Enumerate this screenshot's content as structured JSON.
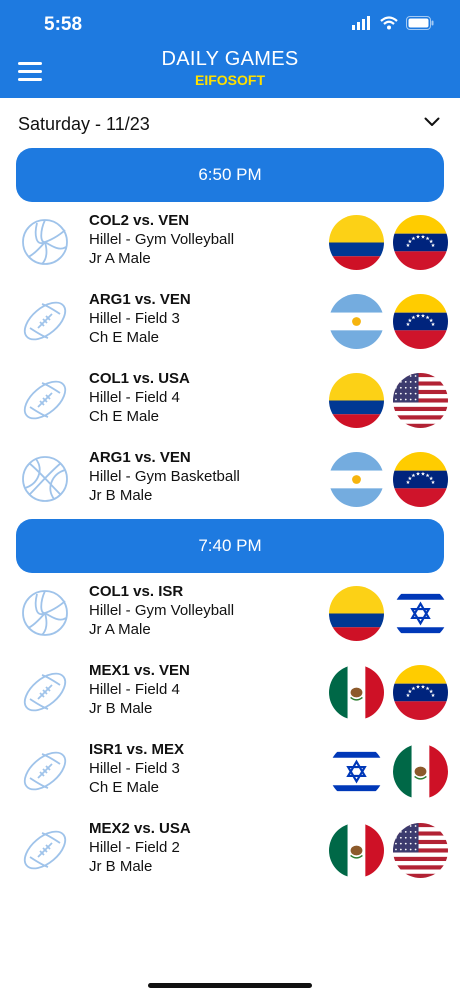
{
  "status_bar": {
    "time": "5:58"
  },
  "header": {
    "title": "DAILY GAMES",
    "subtitle": "EIFOSOFT"
  },
  "date_selector": {
    "label": "Saturday - 11/23"
  },
  "sections": [
    {
      "time": "6:50 PM",
      "games": [
        {
          "title": "COL2 vs. VEN",
          "location": "Hillel - Gym Volleyball",
          "division": "Jr A Male",
          "sport": "volleyball-icon",
          "home": "COL",
          "away": "VEN"
        },
        {
          "title": "ARG1 vs. VEN",
          "location": "Hillel - Field 3",
          "division": "Ch E Male",
          "sport": "football-icon",
          "home": "ARG",
          "away": "VEN"
        },
        {
          "title": "COL1 vs. USA",
          "location": "Hillel - Field 4",
          "division": "Ch E Male",
          "sport": "football-icon",
          "home": "COL",
          "away": "USA"
        },
        {
          "title": "ARG1 vs. VEN",
          "location": "Hillel - Gym Basketball",
          "division": "Jr B Male",
          "sport": "basketball-icon",
          "home": "ARG",
          "away": "VEN"
        }
      ]
    },
    {
      "time": "7:40 PM",
      "games": [
        {
          "title": "COL1 vs. ISR",
          "location": "Hillel - Gym Volleyball",
          "division": "Jr A Male",
          "sport": "volleyball-icon",
          "home": "COL",
          "away": "ISR"
        },
        {
          "title": "MEX1 vs. VEN",
          "location": "Hillel - Field 4",
          "division": "Jr B Male",
          "sport": "football-icon",
          "home": "MEX",
          "away": "VEN"
        },
        {
          "title": "ISR1 vs. MEX",
          "location": "Hillel - Field 3",
          "division": "Ch E Male",
          "sport": "football-icon",
          "home": "ISR",
          "away": "MEX"
        },
        {
          "title": "MEX2 vs. USA",
          "location": "Hillel - Field 2",
          "division": "Jr B Male",
          "sport": "football-icon",
          "home": "MEX",
          "away": "USA"
        }
      ]
    }
  ],
  "colors": {
    "accent": "#1e7ae0",
    "subtitle": "#ffe000",
    "icon_stroke": "#9fc3ea"
  }
}
